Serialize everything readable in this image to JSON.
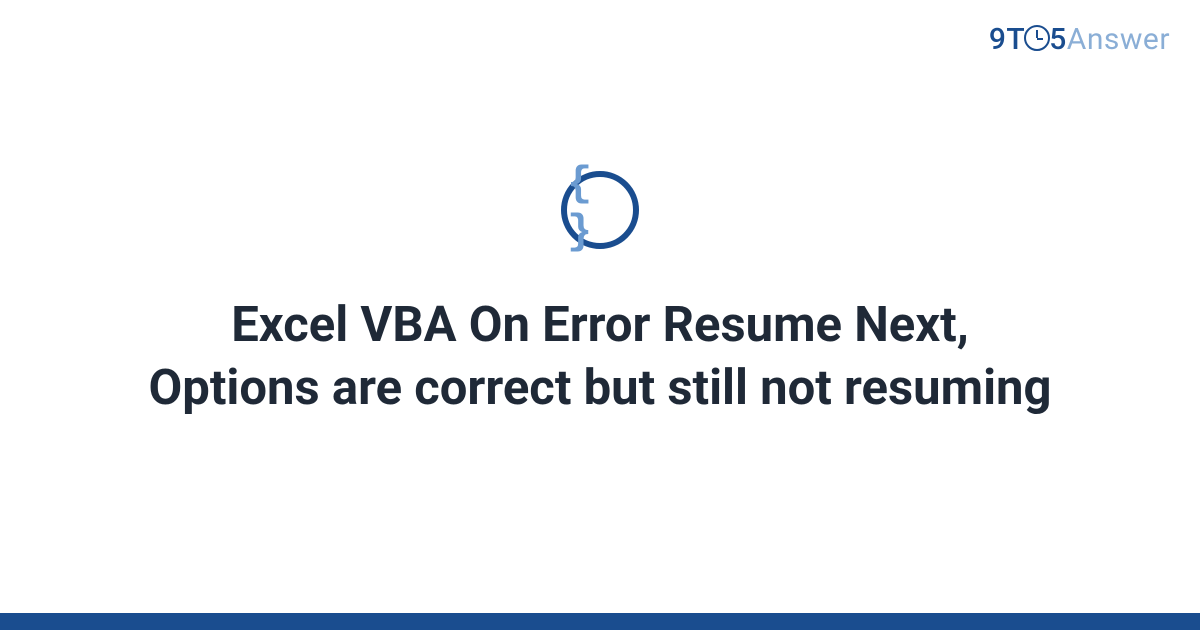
{
  "logo": {
    "part1": "9T",
    "part2": "5",
    "part3": "Answer"
  },
  "icon": {
    "braces": "{ }"
  },
  "title": "Excel VBA On Error Resume Next, Options are correct but still not resuming"
}
